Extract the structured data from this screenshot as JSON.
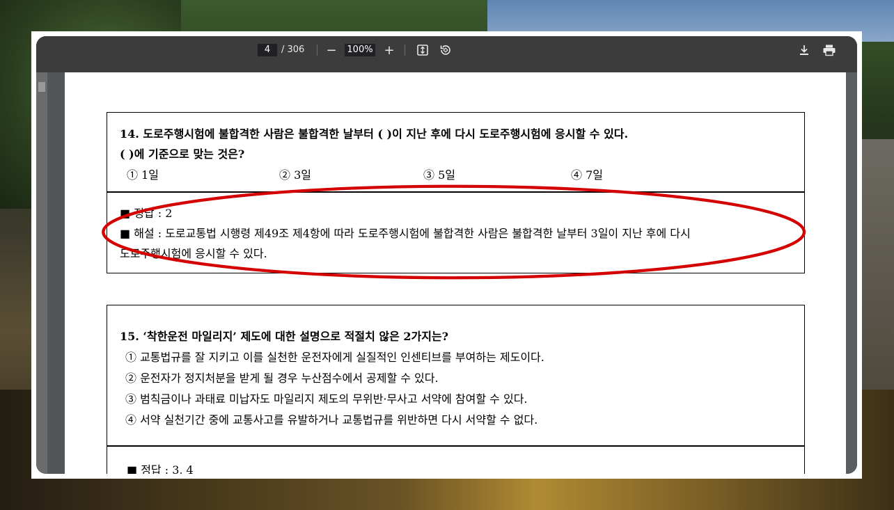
{
  "toolbar": {
    "page_current": "4",
    "page_total": "/ 306",
    "zoom_value": "100%",
    "zoom_out_glyph": "−",
    "zoom_in_glyph": "+",
    "icons": [
      "fit-page-icon",
      "rotate-icon",
      "download-icon",
      "print-icon"
    ]
  },
  "document": {
    "q14": {
      "line1": "14. 도로주행시험에 불합격한 사람은 불합격한 날부터 (   )이 지난 후에 다시 도로주행시험에 응시할 수 있다.",
      "line2": "(    )에 기준으로 맞는 것은?",
      "options": [
        "① 1일",
        "② 3일",
        "③ 5일",
        "④ 7일"
      ],
      "answer": "■ 정답 : 2",
      "explanation1": "■ 해설 : 도로교통법 시행령 제49조 제4항에 따라 도로주행시험에 불합격한 사람은 불합격한 날부터 3일이 지난 후에 다시",
      "explanation2": "도로주행시험에 응시할 수 있다."
    },
    "q15": {
      "title": "15. ‘착한운전 마일리지’ 제도에 대한 설명으로 적절치 않은 2가지는?",
      "options": [
        "① 교통법규를 잘 지키고 이를 실천한 운전자에게 실질적인 인센티브를 부여하는 제도이다.",
        "② 운전자가 정지처분을 받게 될 경우 누산점수에서 공제할 수 있다.",
        "③ 범칙금이나 과태료 미납자도 마일리지 제도의 무위반·무사고 서약에 참여할 수 있다.",
        "④ 서약 실천기간 중에 교통사고를 유발하거나 교통법규를 위반하면 다시 서약할 수 없다."
      ],
      "answer": "■ 정답 : 3, 4"
    }
  },
  "colors": {
    "annotation_red": "#d40000",
    "toolbar_bg": "#3c3c3c",
    "viewer_bg": "#525659"
  }
}
